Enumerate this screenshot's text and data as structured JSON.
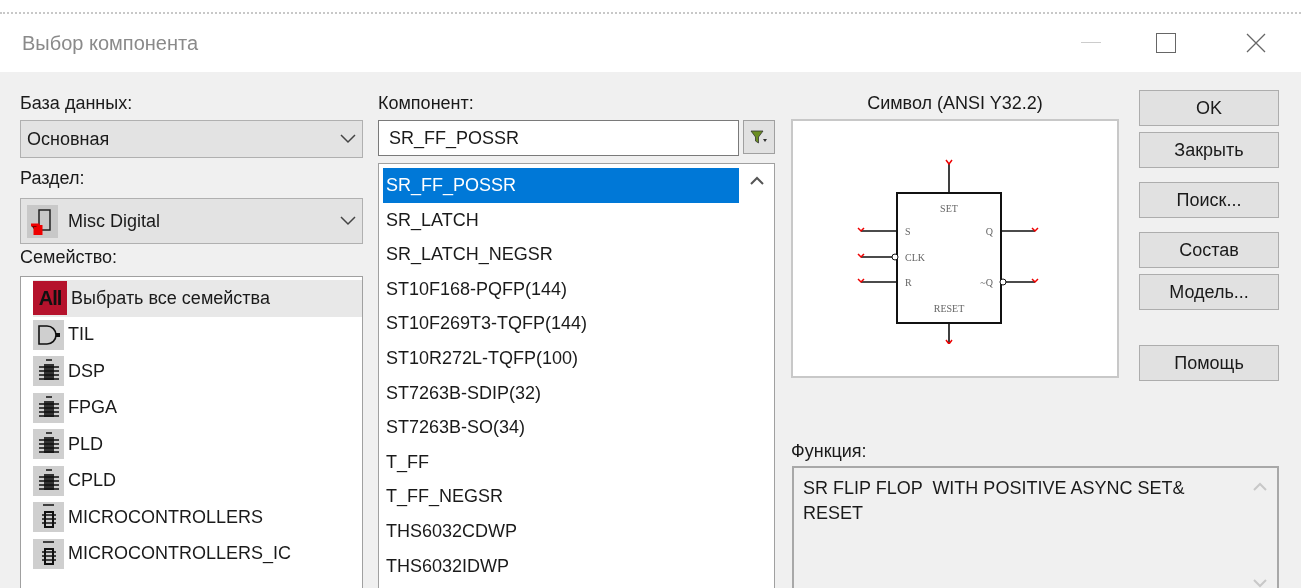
{
  "window": {
    "title": "Выбор компонента"
  },
  "database": {
    "label": "База данных:",
    "value": "Основная"
  },
  "section": {
    "label": "Раздел:",
    "value": "Misc Digital"
  },
  "families": {
    "label": "Семейство:",
    "items": [
      {
        "kind": "all",
        "icon_text": "All",
        "label": "Выбрать все семейства",
        "selected": true
      },
      {
        "kind": "gate",
        "label": "TIL",
        "selected": false
      },
      {
        "kind": "chip",
        "label": "DSP",
        "selected": false
      },
      {
        "kind": "chip",
        "label": "FPGA",
        "selected": false
      },
      {
        "kind": "chip",
        "label": "PLD",
        "selected": false
      },
      {
        "kind": "chip",
        "label": "CPLD",
        "selected": false
      },
      {
        "kind": "mcu",
        "label": "MICROCONTROLLERS",
        "selected": false
      },
      {
        "kind": "mcu",
        "label": "MICROCONTROLLERS_IC",
        "selected": false
      }
    ]
  },
  "component": {
    "label": "Компонент:",
    "value": "SR_FF_POSSR",
    "items": [
      {
        "label": "SR_FF_POSSR",
        "selected": true
      },
      {
        "label": "SR_LATCH",
        "selected": false
      },
      {
        "label": "SR_LATCH_NEGSR",
        "selected": false
      },
      {
        "label": "ST10F168-PQFP(144)",
        "selected": false
      },
      {
        "label": "ST10F269T3-TQFP(144)",
        "selected": false
      },
      {
        "label": "ST10R272L-TQFP(100)",
        "selected": false
      },
      {
        "label": "ST7263B-SDIP(32)",
        "selected": false
      },
      {
        "label": "ST7263B-SO(34)",
        "selected": false
      },
      {
        "label": "T_FF",
        "selected": false
      },
      {
        "label": "T_FF_NEGSR",
        "selected": false
      },
      {
        "label": "THS6032CDWP",
        "selected": false
      },
      {
        "label": "THS6032IDWP",
        "selected": false
      }
    ]
  },
  "symbol": {
    "title": "Символ (ANSI Y32.2)",
    "pins": {
      "top": "SET",
      "left_1": "S",
      "left_2": "CLK",
      "left_3": "R",
      "right_1": "Q",
      "right_3": "~Q",
      "bottom": "RESET"
    }
  },
  "button_groups": [
    [
      "OK",
      "Закрыть"
    ],
    [
      "Поиск..."
    ],
    [
      "Состав",
      "Модель..."
    ],
    [
      "Помощь"
    ]
  ],
  "function": {
    "label": "Функция:",
    "text": "SR FLIP FLOP  WITH POSITIVE ASYNC SET& RESET"
  }
}
